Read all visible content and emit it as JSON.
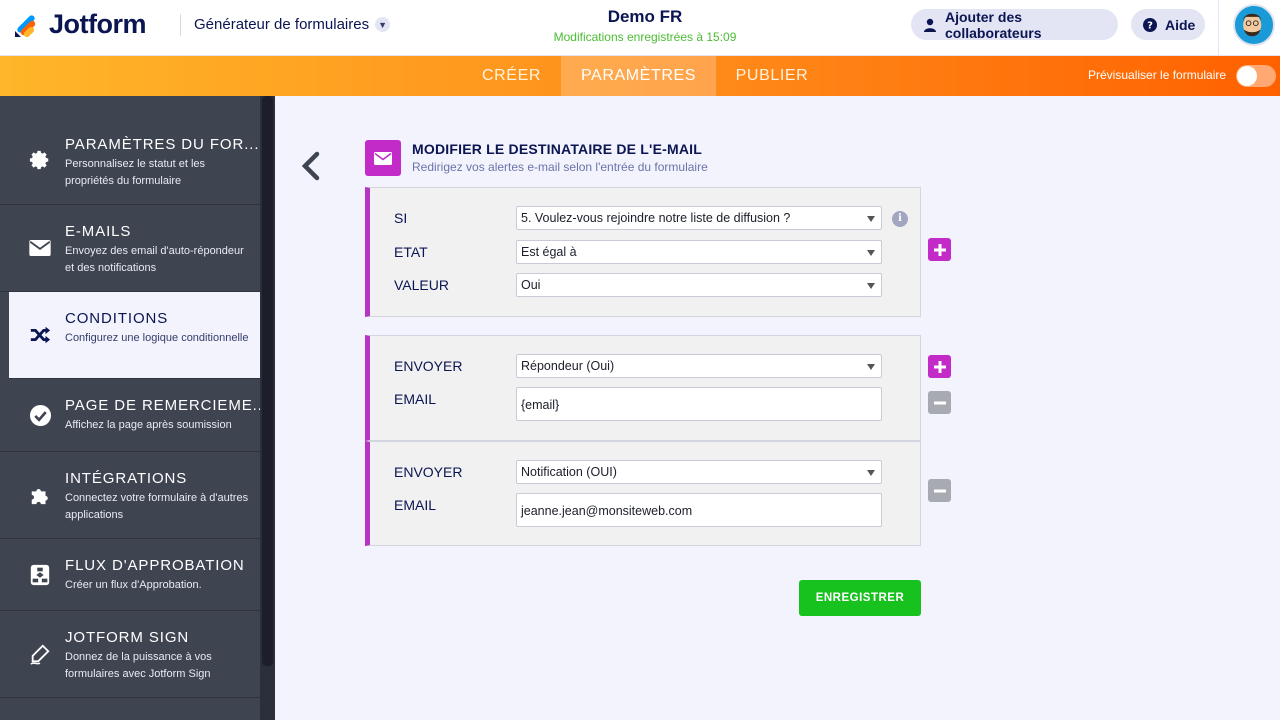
{
  "header": {
    "logo_text": "Jotform",
    "builder_label": "Générateur de formulaires",
    "form_title": "Demo FR",
    "save_status": "Modifications enregistrées à 15:09",
    "collab_label": "Ajouter des collaborateurs",
    "help_label": "Aide"
  },
  "tabs": [
    {
      "label": "CRÉER",
      "active": false
    },
    {
      "label": "PARAMÈTRES",
      "active": true
    },
    {
      "label": "PUBLIER",
      "active": false
    }
  ],
  "preview_label": "Prévisualiser le formulaire",
  "preview_enabled": false,
  "sidebar": [
    {
      "icon": "gear-icon",
      "title": "PARAMÈTRES DU FOR...",
      "desc": "Personnalisez le statut et les propriétés du formulaire",
      "active": false
    },
    {
      "icon": "envelope-icon",
      "title": "E-MAILS",
      "desc": "Envoyez des email d'auto-répondeur et des notifications",
      "active": false
    },
    {
      "icon": "shuffle-icon",
      "title": "CONDITIONS",
      "desc": "Configurez une logique conditionnelle",
      "active": true
    },
    {
      "icon": "check-circle-icon",
      "title": "PAGE DE REMERCIEME...",
      "desc": "Affichez la page après soumission",
      "active": false
    },
    {
      "icon": "puzzle-icon",
      "title": "INTÉGRATIONS",
      "desc": "Connectez votre formulaire à d'autres applications",
      "active": false
    },
    {
      "icon": "flow-icon",
      "title": "FLUX D'APPROBATION",
      "desc": "Créer un flux d'Approbation.",
      "active": false
    },
    {
      "icon": "pen-icon",
      "title": "JOTFORM SIGN",
      "desc": "Donnez de la puissance à vos formulaires avec Jotform Sign",
      "active": false
    }
  ],
  "panel": {
    "title": "MODIFIER LE DESTINATAIRE DE L'E-MAIL",
    "subtitle": "Redirigez vos alertes e-mail selon l'entrée du formulaire",
    "condition": {
      "si_label": "SI",
      "si_value": "5. Voulez-vous rejoindre notre liste de diffusion ?",
      "etat_label": "ETAT",
      "etat_value": "Est égal à",
      "valeur_label": "VALEUR",
      "valeur_value": "Oui"
    },
    "actions": [
      {
        "send_label": "ENVOYER",
        "send_value": "Répondeur (Oui)",
        "email_label": "EMAIL",
        "email_value": "{email}"
      },
      {
        "send_label": "ENVOYER",
        "send_value": "Notification (OUI)",
        "email_label": "EMAIL",
        "email_value": "jeanne.jean@monsiteweb.com"
      }
    ],
    "save_label": "ENREGISTRER"
  },
  "colors": {
    "accent_purple": "#c32bc9",
    "save_green": "#18c21e",
    "sidebar_bg": "#3f4451",
    "tabbar_orange": "#ff8b1a"
  }
}
